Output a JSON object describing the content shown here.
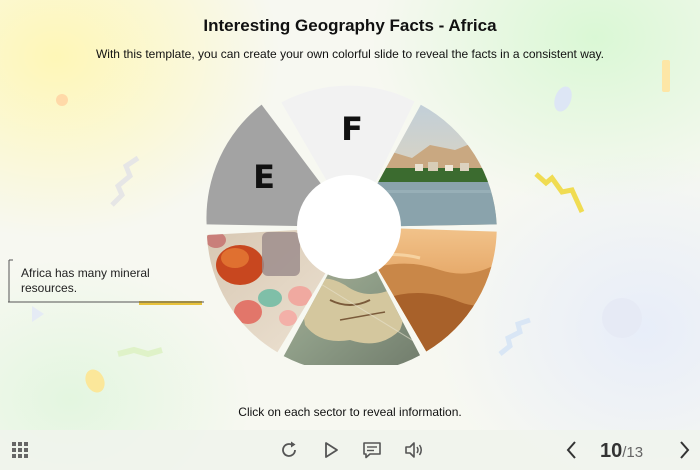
{
  "slide": {
    "title": "Interesting Geography Facts - Africa",
    "subtitle": "With this template, you can create your own colorful slide to reveal the facts in a consistent way.",
    "instruction": "Click on each sector to reveal information.",
    "sectors": [
      {
        "letter": "F",
        "state": "letter"
      },
      {
        "image": "nile-river-village-photo",
        "state": "revealed"
      },
      {
        "image": "sahara-desert-dunes-photo",
        "state": "revealed"
      },
      {
        "image": "vintage-africa-map-photo",
        "state": "revealed"
      },
      {
        "image": "minerals-gemstones-photo",
        "state": "revealed"
      },
      {
        "letter": "E",
        "state": "letter"
      }
    ],
    "callout": {
      "text": "Africa has many mineral resources."
    }
  },
  "player": {
    "current_page": "10",
    "total_pages": "/13",
    "icons": [
      "menu-grid-icon",
      "replay-icon",
      "play-icon",
      "captions-icon",
      "volume-icon",
      "previous-icon",
      "next-icon"
    ]
  },
  "colors": {
    "accent": "#e8c23a",
    "sector_grey": "#a3a3a3",
    "sector_light": "#f2f2f2"
  }
}
